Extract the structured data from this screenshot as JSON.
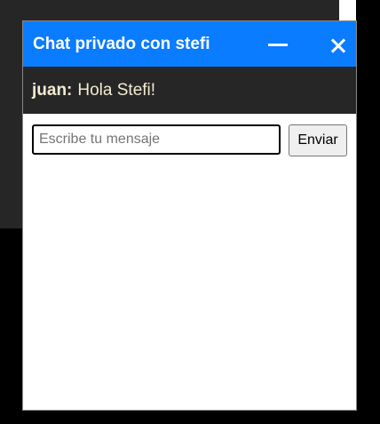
{
  "chat": {
    "title": "Chat privado con stefi",
    "minimize_icon": "minimize-icon",
    "close_icon": "close-icon",
    "messages": [
      {
        "author": "juan:",
        "text": "Hola Stefi!"
      }
    ],
    "input": {
      "placeholder": "Escribe tu mensaje",
      "value": ""
    },
    "send_label": "Enviar"
  },
  "colors": {
    "header": "#0a7cff",
    "messages_background": "#262626",
    "message_text": "#f3ebd2",
    "page_background": "#000000"
  }
}
